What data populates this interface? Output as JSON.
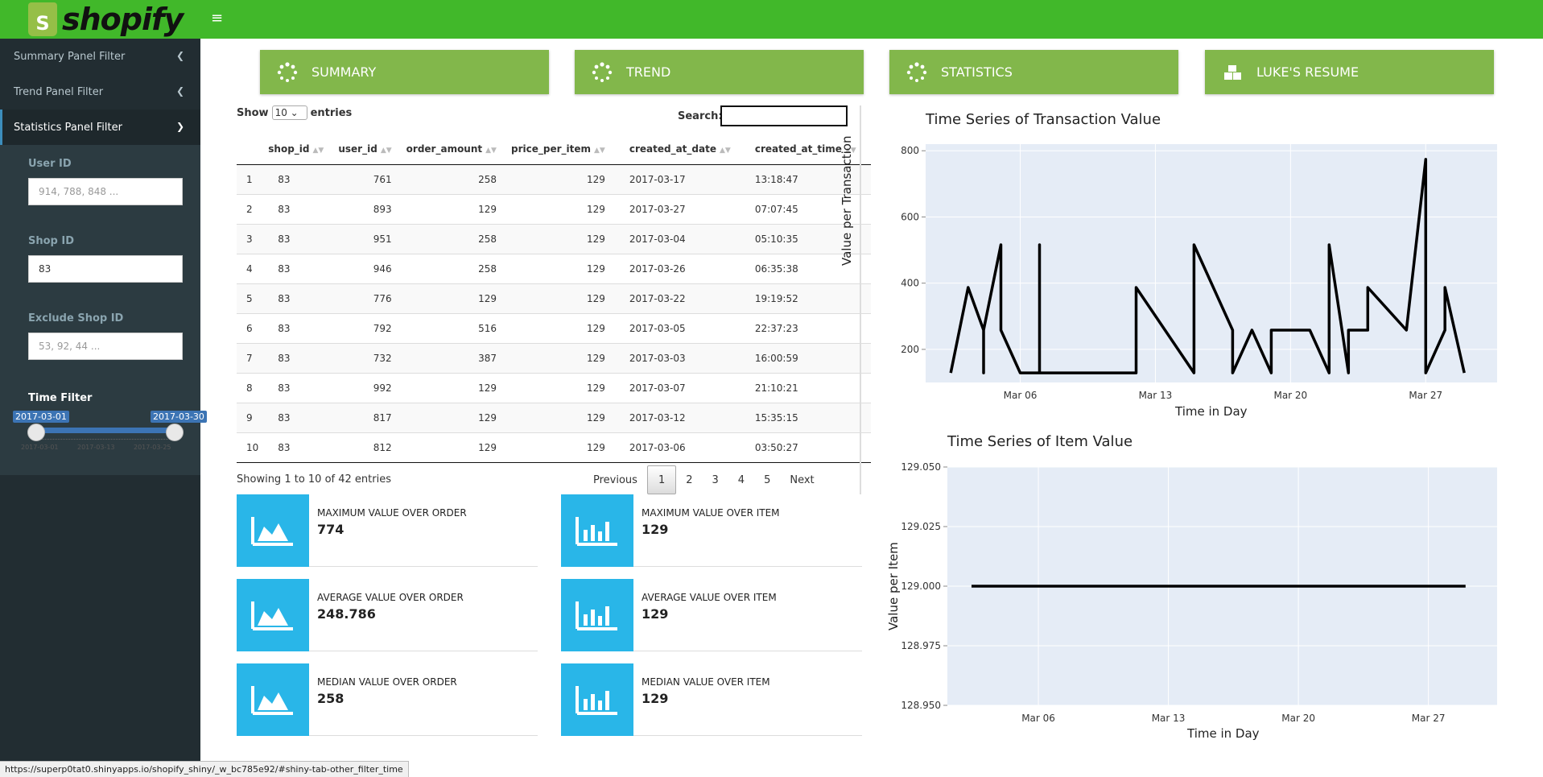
{
  "header": {
    "brand": "shopify",
    "logo_letter": "S"
  },
  "sidebar": {
    "items": [
      {
        "label": "Summary Panel Filter"
      },
      {
        "label": "Trend Panel Filter"
      },
      {
        "label": "Statistics Panel Filter"
      }
    ],
    "filters": {
      "user_id": {
        "label": "User ID",
        "placeholder": "914, 788, 848 ..."
      },
      "shop_id": {
        "label": "Shop ID",
        "value": "83"
      },
      "exclude_shop_id": {
        "label": "Exclude Shop ID",
        "placeholder": "53, 92, 44 ..."
      },
      "time_filter": {
        "label": "Time Filter",
        "from": "2017-03-01",
        "to": "2017-03-30",
        "ticks": [
          "2017-03-01",
          "2017-03-13",
          "2017-03-25"
        ]
      }
    }
  },
  "nav": {
    "summary": "SUMMARY",
    "trend": "TREND",
    "statistics": "STATISTICS",
    "resume": "LUKE'S RESUME"
  },
  "table": {
    "show_label": "Show",
    "entries_label": "entries",
    "page_size": "10",
    "search_label": "Search:",
    "columns": [
      "",
      "shop_id",
      "user_id",
      "order_amount",
      "price_per_item",
      "created_at_date",
      "created_at_time"
    ],
    "rows": [
      [
        "1",
        "83",
        "761",
        "258",
        "129",
        "2017-03-17",
        "13:18:47"
      ],
      [
        "2",
        "83",
        "893",
        "129",
        "129",
        "2017-03-27",
        "07:07:45"
      ],
      [
        "3",
        "83",
        "951",
        "258",
        "129",
        "2017-03-04",
        "05:10:35"
      ],
      [
        "4",
        "83",
        "946",
        "258",
        "129",
        "2017-03-26",
        "06:35:38"
      ],
      [
        "5",
        "83",
        "776",
        "129",
        "129",
        "2017-03-22",
        "19:19:52"
      ],
      [
        "6",
        "83",
        "792",
        "516",
        "129",
        "2017-03-05",
        "22:37:23"
      ],
      [
        "7",
        "83",
        "732",
        "387",
        "129",
        "2017-03-03",
        "16:00:59"
      ],
      [
        "8",
        "83",
        "992",
        "129",
        "129",
        "2017-03-07",
        "21:10:21"
      ],
      [
        "9",
        "83",
        "817",
        "129",
        "129",
        "2017-03-12",
        "15:35:15"
      ],
      [
        "10",
        "83",
        "812",
        "129",
        "129",
        "2017-03-06",
        "03:50:27"
      ]
    ],
    "info": "Showing 1 to 10 of 42 entries",
    "pager": {
      "previous": "Previous",
      "pages": [
        "1",
        "2",
        "3",
        "4",
        "5"
      ],
      "current": "1",
      "next": "Next"
    }
  },
  "stats": [
    {
      "title": "MAXIMUM VALUE OVER ORDER",
      "value": "774",
      "icon": "area-chart-icon"
    },
    {
      "title": "MAXIMUM VALUE OVER ITEM",
      "value": "129",
      "icon": "bar-chart-icon"
    },
    {
      "title": "AVERAGE VALUE OVER ORDER",
      "value": "248.786",
      "icon": "area-chart-icon"
    },
    {
      "title": "AVERAGE VALUE OVER ITEM",
      "value": "129",
      "icon": "bar-chart-icon"
    },
    {
      "title": "MEDIAN VALUE OVER ORDER",
      "value": "258",
      "icon": "area-chart-icon"
    },
    {
      "title": "MEDIAN VALUE OVER ITEM",
      "value": "129",
      "icon": "bar-chart-icon"
    }
  ],
  "status_bar": {
    "url": "https://superp0tat0.shinyapps.io/shopify_shiny/_w_bc785e92/#shiny-tab-other_filter_time"
  },
  "colors": {
    "topbar": "#41b82a",
    "nav_button": "#82b74b",
    "info_icon": "#29b6e8",
    "plot_bg": "#e5ecf6",
    "sidebar": "#222d32"
  },
  "chart_data": [
    {
      "type": "line",
      "title": "Time Series of Transaction Value",
      "xlabel": "Time in Day",
      "ylabel": "Value per Transaction",
      "x_tick_labels": [
        "Mar 06",
        "Mar 13",
        "Mar 20",
        "Mar 27"
      ],
      "x_tick_values": [
        6,
        13,
        20,
        27
      ],
      "y_tick_labels": [
        "200",
        "400",
        "600",
        "800"
      ],
      "y_tick_values": [
        200,
        400,
        600,
        800
      ],
      "xlim": [
        1.1,
        30.7
      ],
      "ylim": [
        100,
        820
      ],
      "series": [
        {
          "x": [
            2.4,
            3.3,
            4.1,
            4.1,
            4.1,
            5.0,
            5.0,
            6.0,
            7.0,
            7.0,
            7.0,
            12.0,
            12.0,
            15.0,
            15.0,
            17.0,
            17.0,
            18.0,
            19.0,
            19.0,
            21.0,
            22.0,
            22.0,
            23.0,
            23.0,
            24.0,
            24.0,
            26.0,
            27.0,
            27.0,
            28.0,
            28.0,
            29.0
          ],
          "y": [
            129,
            387,
            258,
            129,
            258,
            516,
            258,
            129,
            129,
            516,
            129,
            129,
            387,
            129,
            516,
            258,
            129,
            258,
            129,
            258,
            258,
            129,
            516,
            129,
            258,
            258,
            387,
            258,
            774,
            129,
            258,
            387,
            129
          ]
        }
      ],
      "grid": true
    },
    {
      "type": "line",
      "title": "Time Series of Item Value",
      "xlabel": "Time in Day",
      "ylabel": "Value per Item",
      "x_tick_labels": [
        "Mar 06",
        "Mar 13",
        "Mar 20",
        "Mar 27"
      ],
      "x_tick_values": [
        6,
        13,
        20,
        27
      ],
      "y_tick_labels": [
        "128.950",
        "128.975",
        "129.000",
        "129.025",
        "129.050"
      ],
      "y_tick_values": [
        128.95,
        128.975,
        129.0,
        129.025,
        129.05
      ],
      "xlim": [
        1.1,
        30.7
      ],
      "ylim": [
        128.95,
        129.05
      ],
      "series": [
        {
          "x": [
            2.4,
            29.0
          ],
          "y": [
            129,
            129
          ]
        }
      ],
      "grid": true
    }
  ]
}
